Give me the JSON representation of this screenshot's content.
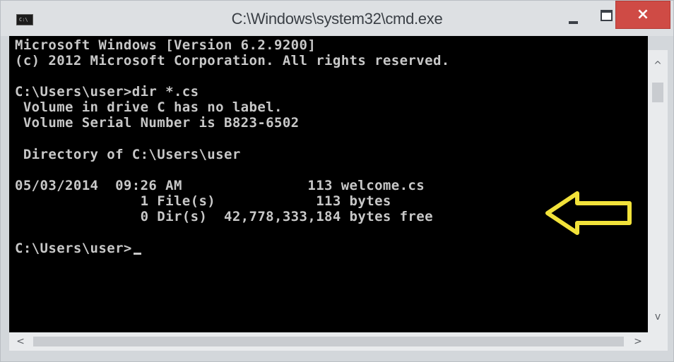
{
  "window": {
    "title": "C:\\Windows\\system32\\cmd.exe",
    "app_icon_text": "C:\\",
    "close_glyph": "×",
    "accent_color": "#cf4b45",
    "annotation_arrow_color": "#f2e23a"
  },
  "console": {
    "lines": [
      "Microsoft Windows [Version 6.2.9200]",
      "(c) 2012 Microsoft Corporation. All rights reserved.",
      "C:\\Users\\user>dir *.cs",
      " Volume in drive C has no label.",
      " Volume Serial Number is B823-6502",
      " Directory of C:\\Users\\user",
      "05/03/2014  09:26 AM               113 welcome.cs",
      "               1 File(s)            113 bytes",
      "               0 Dir(s)  42,778,333,184 bytes free",
      "C:\\Users\\user>"
    ]
  },
  "scrollbars": {
    "up_arrow": "^",
    "down_arrow": "v",
    "left_arrow": "<",
    "right_arrow": ">"
  }
}
